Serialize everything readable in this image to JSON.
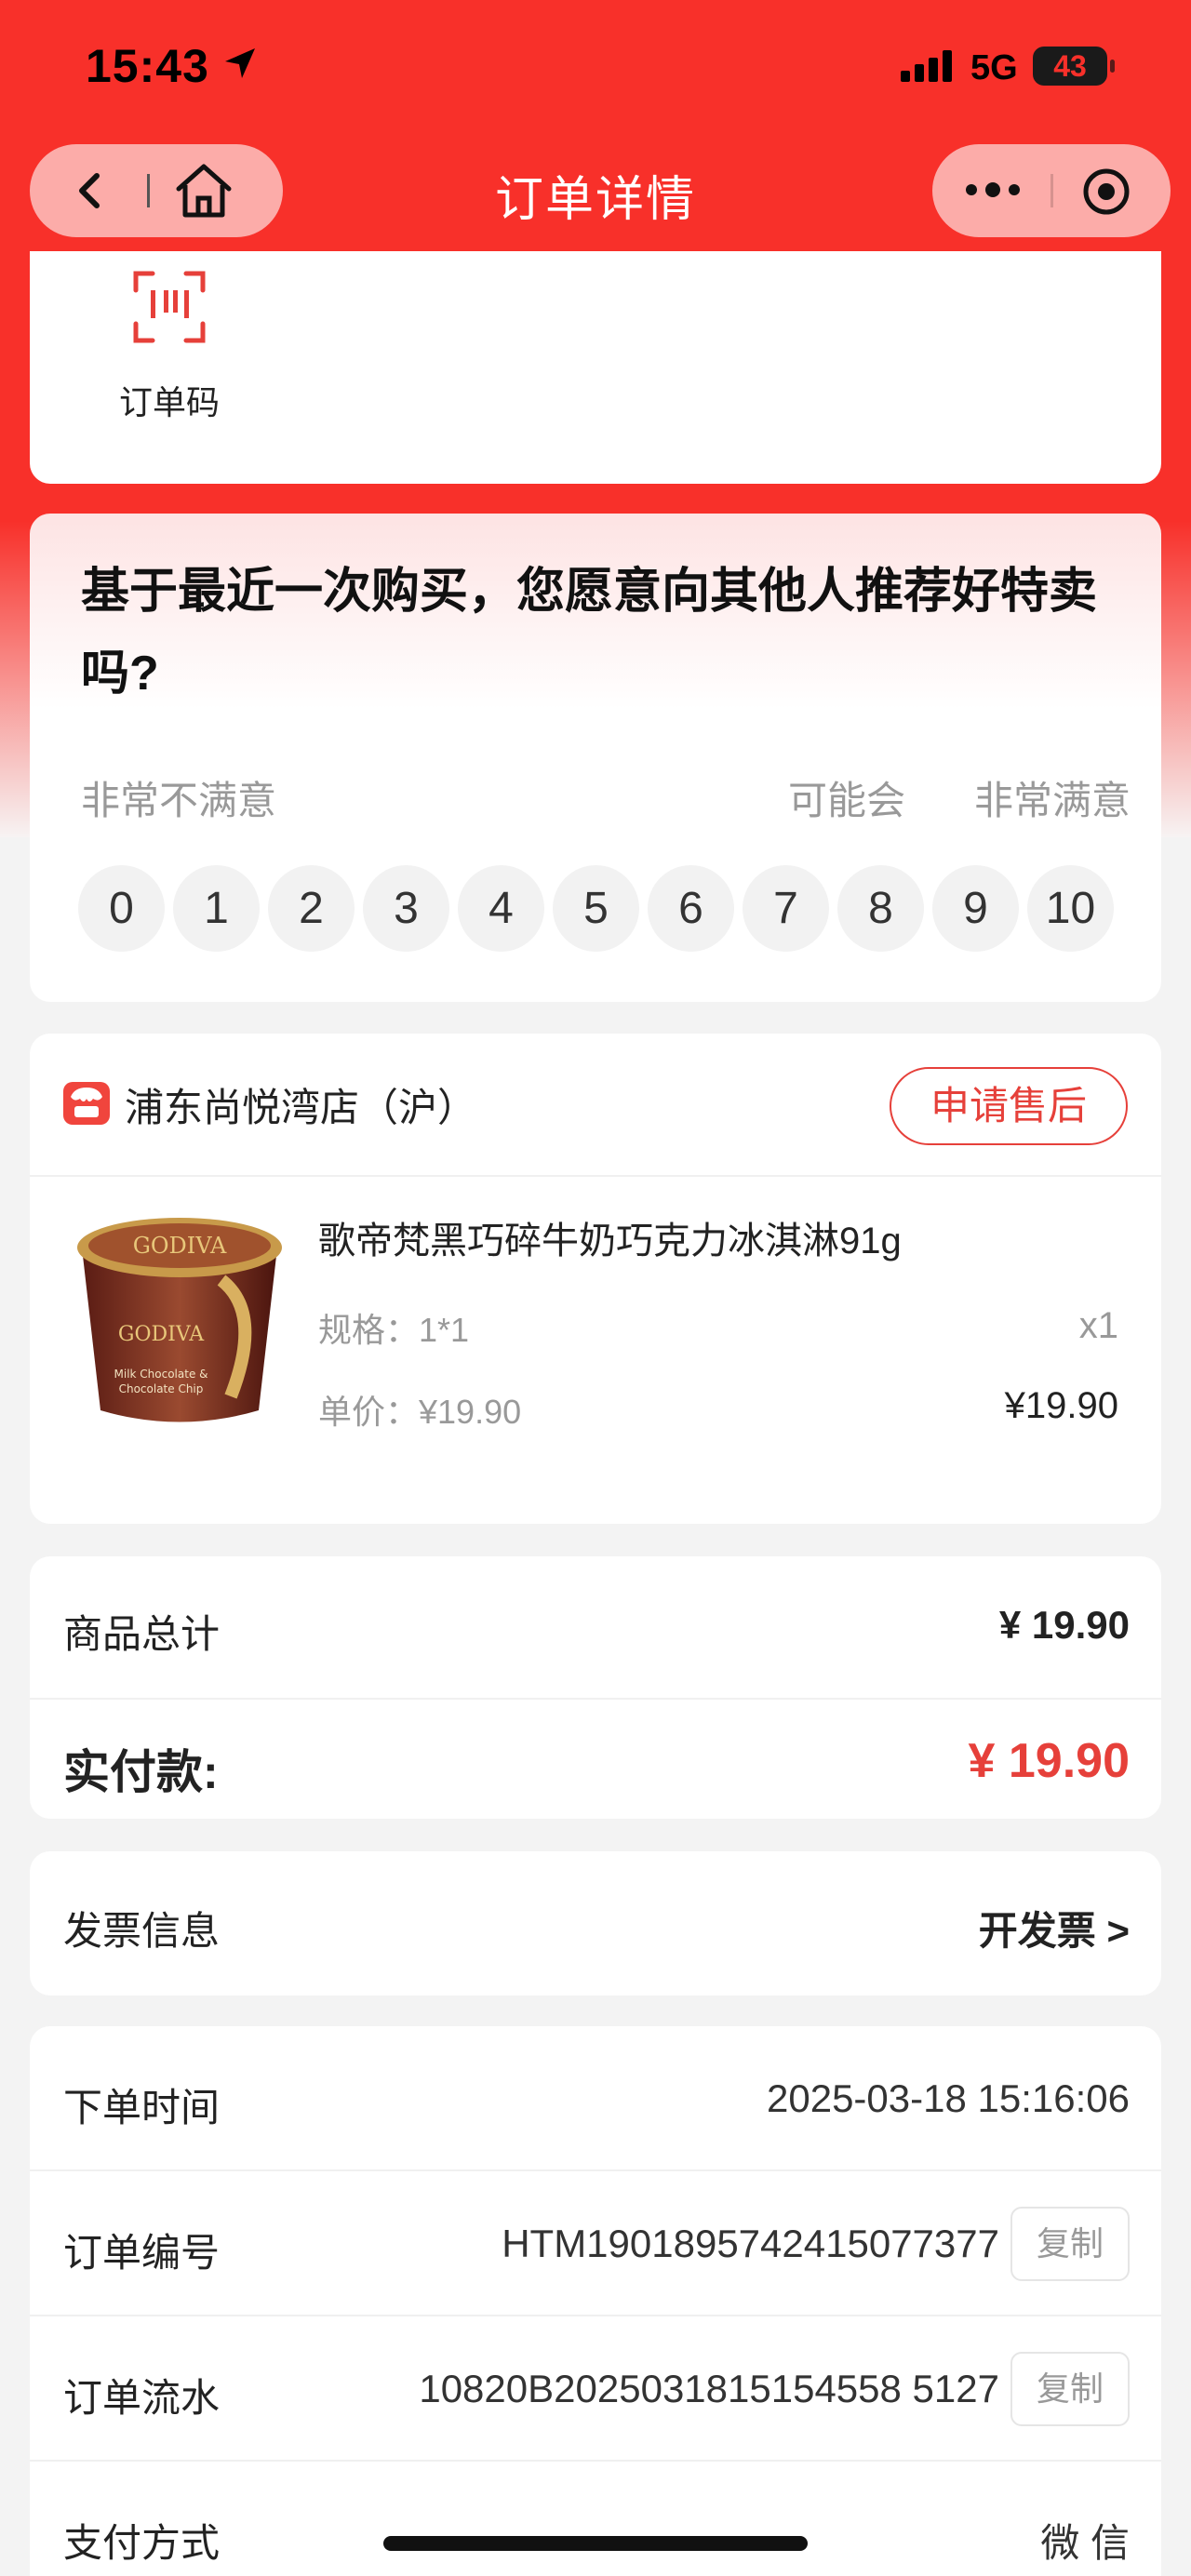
{
  "status_bar": {
    "time": "15:43",
    "network": "5G",
    "battery": "43"
  },
  "nav": {
    "title": "订单详情"
  },
  "order_code": {
    "label": "订单码"
  },
  "survey": {
    "question": "基于最近一次购买，您愿意向其他人推荐好特卖吗?",
    "label_low": "非常不满意",
    "label_mid": "可能会",
    "label_high": "非常满意",
    "scores": [
      "0",
      "1",
      "2",
      "3",
      "4",
      "5",
      "6",
      "7",
      "8",
      "9",
      "10"
    ]
  },
  "store": {
    "name": "浦东尚悦湾店（沪）",
    "after_sale_label": "申请售后"
  },
  "product": {
    "name": "歌帝梵黑巧碎牛奶巧克力冰淇淋91g",
    "spec": "规格：1*1",
    "qty": "x1",
    "unit_price": "单价：¥19.90",
    "price": "¥19.90",
    "image_brand": "GODIVA",
    "image_caption": "Milk Chocolate & Chocolate Chip"
  },
  "summary": {
    "total_label": "商品总计",
    "total_value": "¥ 19.90",
    "paid_label": "实付款:",
    "paid_value": "¥ 19.90"
  },
  "invoice": {
    "label": "发票信息",
    "action": "开发票 >"
  },
  "order_info": {
    "time_label": "下单时间",
    "time_value": "2025-03-18 15:16:06",
    "number_label": "订单编号",
    "number_value": "HTM1901895742415077377",
    "serial_label": "订单流水",
    "serial_value": "10820B2025031815154558 5127",
    "pay_label": "支付方式",
    "pay_value": "微 信",
    "copy_label": "复制"
  },
  "colors": {
    "brand_red": "#f8302a",
    "accent_red": "#e6403a"
  }
}
